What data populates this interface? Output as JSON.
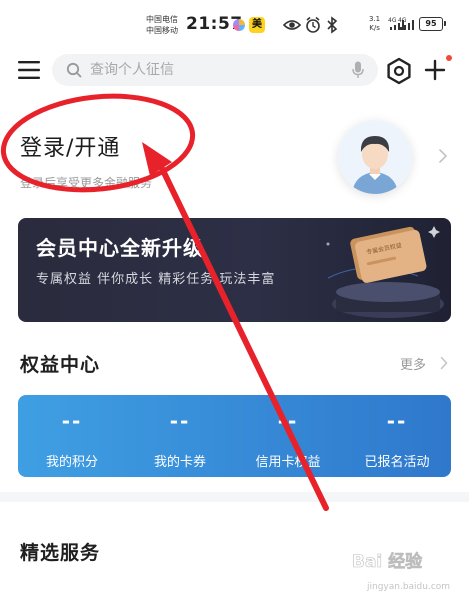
{
  "status_bar": {
    "carrier_1": "中国电信",
    "carrier_2": "中国移动",
    "time": "21:57",
    "app_badge": "美",
    "speed_value": "3.1",
    "speed_unit": "K/s",
    "network_1": "4G",
    "network_2": "4G",
    "battery": "95"
  },
  "header": {
    "search_placeholder": "查询个人征信"
  },
  "login": {
    "title": "登录/开通",
    "subtitle": "登录后享受更多金融服务"
  },
  "banner": {
    "title": "会员中心全新升级",
    "subtitle": "专属权益 伴你成长 精彩任务 玩法丰富",
    "card_text": "专属会员权益"
  },
  "rights": {
    "title": "权益中心",
    "more_label": "更多",
    "items": [
      {
        "value": "--",
        "label": "我的积分"
      },
      {
        "value": "--",
        "label": "我的卡券"
      },
      {
        "value": "--",
        "label": "信用卡权益"
      },
      {
        "value": "--",
        "label": "已报名活动"
      }
    ]
  },
  "services": {
    "title": "精选服务"
  },
  "watermark": {
    "brand": "Bai 经验",
    "url": "jingyan.baidu.com"
  },
  "colors": {
    "annotation_red": "#e8222b",
    "rights_gradient_start": "#3f9fe3",
    "rights_gradient_end": "#2f78cc",
    "banner_bg": "#2a2b3d"
  }
}
